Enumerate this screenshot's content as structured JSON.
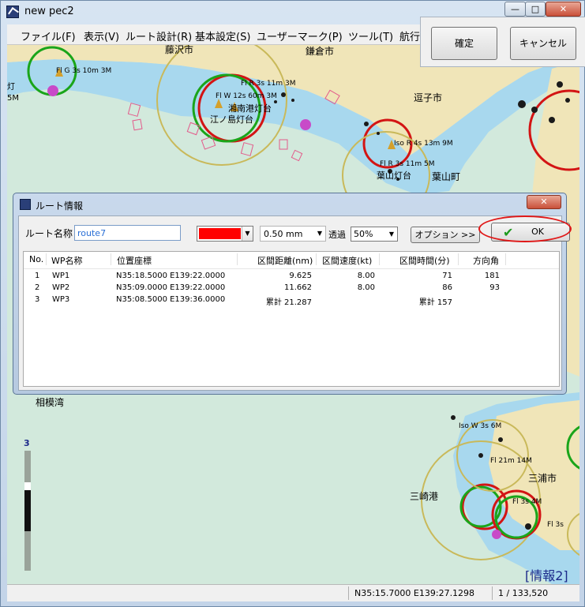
{
  "window": {
    "title": "new pec2",
    "controls": {
      "minimize": "—",
      "maximize": "□",
      "close": "✕"
    }
  },
  "menu": [
    "ファイル(F)",
    "表示(V)",
    "ルート設計(R)",
    "基本設定(S)",
    "ユーザーマーク(P)",
    "ツール(T)",
    "航行"
  ],
  "confirm_panel": {
    "confirm": "確定",
    "cancel": "キャンセル"
  },
  "map": {
    "place_names": [
      "藤沢市",
      "鎌倉市",
      "逗子市",
      "葉山町",
      "相模湾",
      "三浦市",
      "三崎港",
      "江ノ島灯台",
      "湘南港灯台",
      "葉山灯台"
    ],
    "light_labels": [
      "Fl G 3s 10m 3M",
      "Fl R 3s 11m 3M",
      "Fl W 12s 60m 3M",
      "Iso R 4s 13m 9M",
      "Fl R 3s 11m 5M",
      "Iso W 3s 6M",
      "Fl 21m 14M",
      "Fl 3s 4M",
      "Fl 3s"
    ],
    "left_edge_labels": [
      "灯",
      "5M"
    ],
    "scale_indicator": "3",
    "info_label": "[情報2]",
    "colors": {
      "sea": "#d2e9dc",
      "shallow": "#a8d8ee",
      "land": "#f0e5b8",
      "circle_green": "#1aa51a",
      "circle_red": "#d31414",
      "circle_yellow": "#c9b95a",
      "magenta": "#c84ac8"
    }
  },
  "dialog": {
    "title": "ルート情報",
    "close": "✕",
    "route_name_label": "ルート名称",
    "route_name_value": "route7",
    "color": "#ff0000",
    "line_width": "0.50 mm",
    "transparency_label": "透過",
    "transparency_value": "50%",
    "option_button": "オプション >>",
    "ok_button": "OK",
    "table": {
      "headers": [
        "No.",
        "WP名称",
        "位置座標",
        "区間距離(nm)",
        "区間速度(kt)",
        "区間時間(分)",
        "方向角"
      ],
      "rows": [
        {
          "no": "1",
          "name": "WP1",
          "pos": "N35:18.5000  E139:22.0000",
          "dist": "9.625",
          "speed": "8.00",
          "time": "71",
          "bearing": "181"
        },
        {
          "no": "2",
          "name": "WP2",
          "pos": "N35:09.0000  E139:22.0000",
          "dist": "11.662",
          "speed": "8.00",
          "time": "86",
          "bearing": "93"
        },
        {
          "no": "3",
          "name": "WP3",
          "pos": "N35:08.5000  E139:36.0000",
          "dist": "累計  21.287",
          "speed": "",
          "time": "累計    157",
          "bearing": ""
        }
      ]
    }
  },
  "status": {
    "coord": "N35:15.7000 E139:27.1298",
    "scale": "1 / 133,520"
  }
}
